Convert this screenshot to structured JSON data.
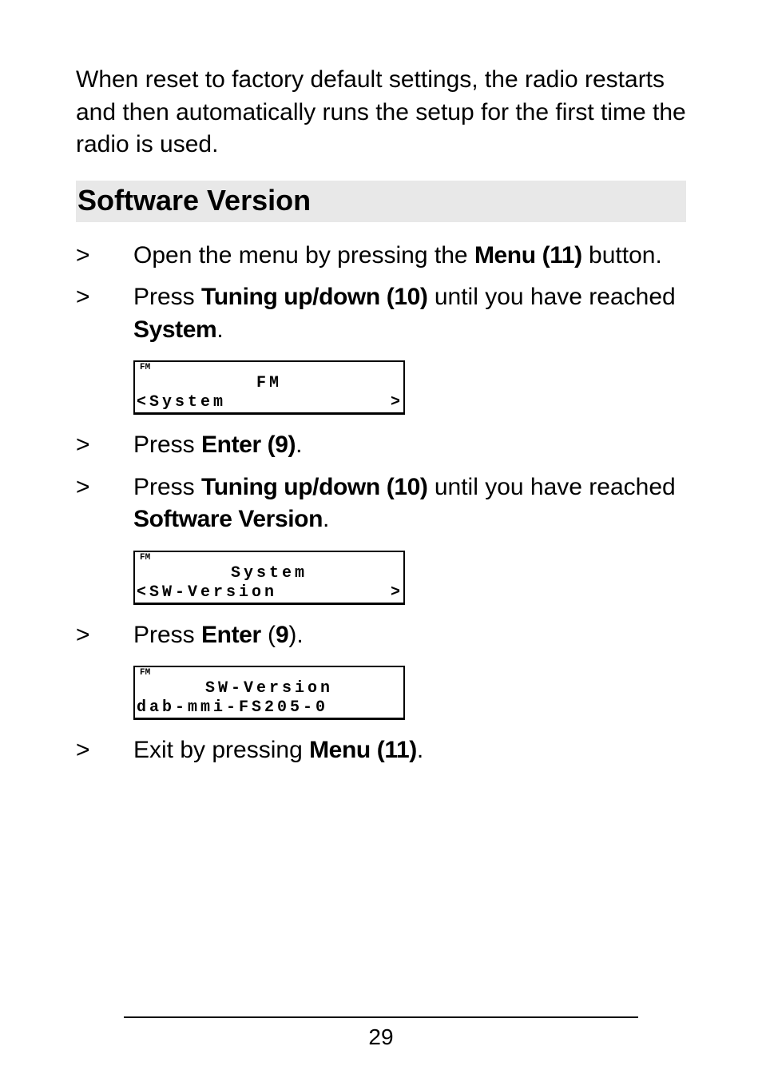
{
  "intro": "When reset to factory default settings, the radio restarts and then automatically runs the setup for the first time the radio is used.",
  "heading": "Software Version",
  "steps": {
    "marker": ">",
    "s1a": "Open the menu by pressing the ",
    "s1b": "Menu (11)",
    "s1c": " button.",
    "s2a": "Press ",
    "s2b": "Tuning up/down (10)",
    "s2c": " until you have reached ",
    "s2d": "System",
    "s2e": ".",
    "s3a": "Press ",
    "s3b": "Enter (9)",
    "s3c": ".",
    "s4a": "Press ",
    "s4b": "Tuning up/down (10)",
    "s4c": " until you have reached ",
    "s4d": "Software Version",
    "s4e": ".",
    "s5a": "Press ",
    "s5b": "Enter",
    "s5c": " (",
    "s5d": "9",
    "s5e": ").",
    "s6a": "Exit by pressing ",
    "s6b": "Menu (11)",
    "s6c": "."
  },
  "lcd1": {
    "corner": "FM",
    "center": "FM",
    "bottom_left": "<System",
    "bottom_right": ">"
  },
  "lcd2": {
    "corner": "FM",
    "center": "System",
    "bottom_left": "<SW-Version",
    "bottom_right": ">"
  },
  "lcd3": {
    "corner": "FM",
    "center": "SW-Version",
    "bottom_left": "dab-mmi-FS205-0",
    "bottom_right": ""
  },
  "page_number": "29"
}
